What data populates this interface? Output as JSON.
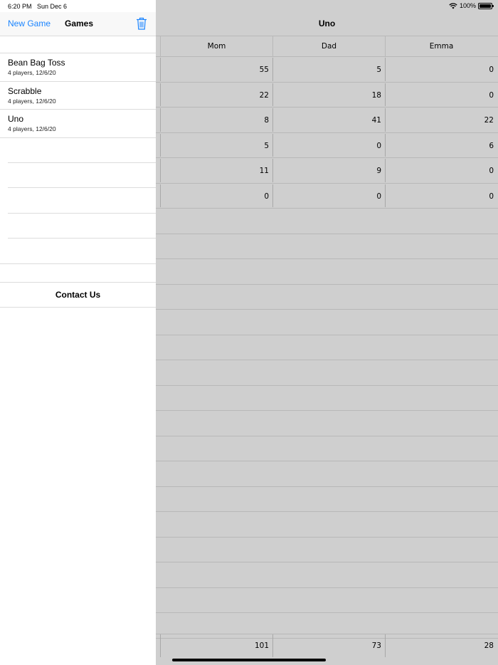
{
  "status_bar": {
    "time": "6:20 PM",
    "date": "Sun Dec 6",
    "battery": "100%",
    "battery_level": 1.0
  },
  "sidebar": {
    "new_game_label": "New Game",
    "title": "Games",
    "games": [
      {
        "name": "Bean Bag Toss",
        "details": "4 players, 12/6/20"
      },
      {
        "name": "Scrabble",
        "details": "4 players, 12/6/20"
      },
      {
        "name": "Uno",
        "details": "4 players, 12/6/20"
      }
    ],
    "contact_label": "Contact Us"
  },
  "main": {
    "title": "Uno",
    "players": [
      "Mom",
      "Dad",
      "Emma"
    ],
    "rows": [
      [
        "55",
        "5",
        "0"
      ],
      [
        "22",
        "18",
        "0"
      ],
      [
        "8",
        "41",
        "22"
      ],
      [
        "5",
        "0",
        "6"
      ],
      [
        "11",
        "9",
        "0"
      ],
      [
        "0",
        "0",
        "0"
      ]
    ],
    "totals": [
      "101",
      "73",
      "28"
    ]
  }
}
